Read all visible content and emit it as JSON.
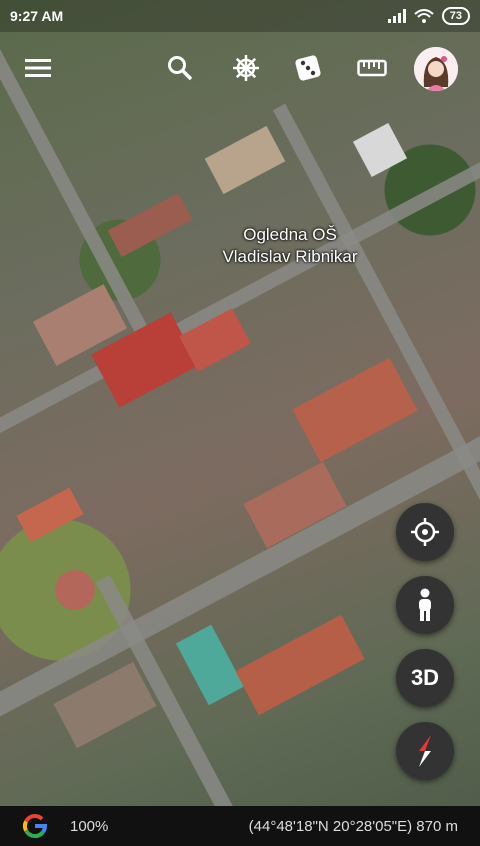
{
  "status_bar": {
    "time": "9:27 AM",
    "battery": "73"
  },
  "toolbar": {
    "menu_icon": "hamburger-menu-icon",
    "search_icon": "search-icon",
    "voyager_icon": "ship-wheel-icon",
    "feeling_lucky_icon": "dice-icon",
    "measure_icon": "ruler-icon",
    "avatar": "user-avatar"
  },
  "map": {
    "place_label_line1": "Ogledna OŠ",
    "place_label_line2": "Vladislav Ribnikar"
  },
  "controls": {
    "locate_icon": "crosshair-icon",
    "street_view_icon": "pegman-icon",
    "three_d_label": "3D",
    "compass_icon": "compass-icon"
  },
  "bottom_bar": {
    "logo": "google-g-logo",
    "zoom": "100%",
    "coordinates": "(44°48'18\"N 20°28'05\"E) 870 m"
  },
  "colors": {
    "accent_compass": "#e53935",
    "fab_bg": "#333333",
    "bottom_bar_bg": "#111111"
  }
}
